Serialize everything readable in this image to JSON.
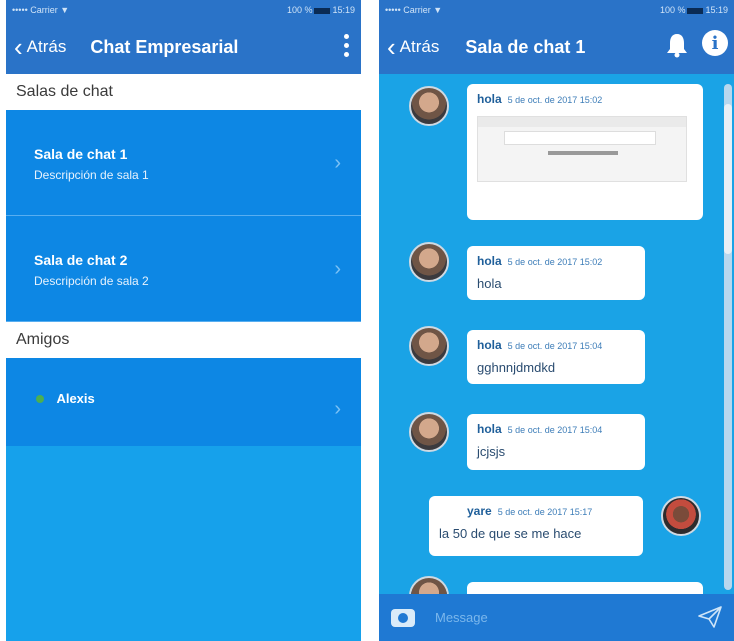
{
  "left": {
    "status": {
      "carrier": "••••• Carrier",
      "wifi": "▼",
      "battery": "100 %",
      "time": "15:19"
    },
    "nav": {
      "back": "Atrás",
      "title": "Chat Empresarial"
    },
    "section_rooms": "Salas de chat",
    "rooms": [
      {
        "name": "Sala de chat 1",
        "desc": "Descripción de sala 1"
      },
      {
        "name": "Sala de chat 2",
        "desc": "Descripción de sala 2"
      }
    ],
    "section_friends": "Amigos",
    "friends": [
      {
        "name": "Alexis",
        "status_color": "#4caf50"
      }
    ]
  },
  "right": {
    "status": {
      "carrier": "••••• Carrier",
      "wifi": "▼",
      "battery": "100 %",
      "time": "15:19"
    },
    "nav": {
      "back": "Atrás",
      "title": "Sala de chat 1"
    },
    "messages": [
      {
        "user": "hola",
        "time": "5 de oct. de 2017 15:02",
        "text": "",
        "attachment": "screenshot"
      },
      {
        "user": "hola",
        "time": "5 de oct. de 2017 15:02",
        "text": "hola"
      },
      {
        "user": "hola",
        "time": "5 de oct. de 2017 15:04",
        "text": "gghnnjdmdkd"
      },
      {
        "user": "hola",
        "time": "5 de oct. de 2017 15:04",
        "text": "jcjsjs"
      },
      {
        "user": "yare",
        "time": "5 de oct. de 2017 15:17",
        "text": "la 50 de que se me hace"
      }
    ],
    "composer": {
      "placeholder": "Message"
    }
  },
  "colors": {
    "navbar": "#2a73c8",
    "row": "#0d87e4",
    "chat_bg": "#1aa3e6",
    "composer": "#1f79d3"
  },
  "icons": [
    "chevron-left-icon",
    "kebab-menu-icon",
    "chevron-right-icon",
    "bell-icon",
    "info-icon",
    "camera-icon",
    "send-icon",
    "online-dot-icon"
  ]
}
